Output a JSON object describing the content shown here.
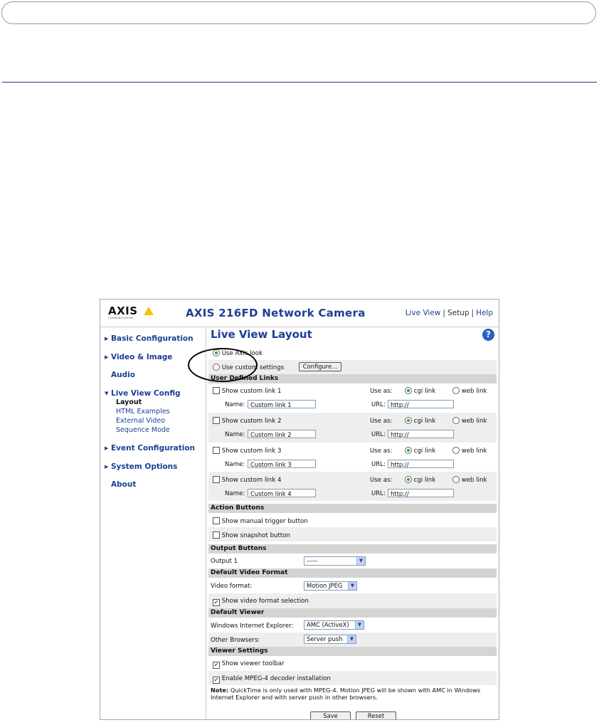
{
  "document": {},
  "app": {
    "logo_text": "AXIS",
    "logo_sub": "COMMUNICATIONS",
    "product_title": "AXIS 216FD Network Camera",
    "top_links": [
      "Live View",
      "Setup",
      "Help"
    ],
    "separator": "|"
  },
  "nav": {
    "items": [
      {
        "label": "Basic Configuration",
        "arrow": "▶"
      },
      {
        "label": "Video & Image",
        "arrow": "▶"
      },
      {
        "label": "Audio",
        "arrow": ""
      },
      {
        "label": "Live View Config",
        "arrow": "▼"
      },
      {
        "label": "Event Configuration",
        "arrow": "▶"
      },
      {
        "label": "System Options",
        "arrow": "▶"
      },
      {
        "label": "About",
        "arrow": ""
      }
    ],
    "sub_items": [
      "Layout",
      "HTML Examples",
      "External Video",
      "Sequence Mode"
    ]
  },
  "page": {
    "title": "Live View Layout",
    "help_glyph": "?",
    "use_axis_look": "Use Axis look",
    "use_custom_settings": "Use custom settings",
    "configure_button": "Configure..."
  },
  "sections": {
    "user_defined_links": "User Defined Links",
    "action_buttons": "Action Buttons",
    "output_buttons": "Output Buttons",
    "default_video_format": "Default Video Format",
    "default_viewer": "Default Viewer",
    "viewer_settings": "Viewer Settings"
  },
  "custom_links": [
    {
      "label": "Show custom link 1",
      "name_label": "Name:",
      "name": "Custom link 1",
      "use_as": "Use as:",
      "cgi": "cgi link",
      "web": "web link",
      "url_label": "URL:",
      "url": "http://"
    },
    {
      "label": "Show custom link 2",
      "name_label": "Name:",
      "name": "Custom link 2",
      "use_as": "Use as:",
      "cgi": "cgi link",
      "web": "web link",
      "url_label": "URL:",
      "url": "http://"
    },
    {
      "label": "Show custom link 3",
      "name_label": "Name:",
      "name": "Custom link 3",
      "use_as": "Use as:",
      "cgi": "cgi link",
      "web": "web link",
      "url_label": "URL:",
      "url": "http://"
    },
    {
      "label": "Show custom link 4",
      "name_label": "Name:",
      "name": "Custom link 4",
      "use_as": "Use as:",
      "cgi": "cgi link",
      "web": "web link",
      "url_label": "URL:",
      "url": "http://"
    }
  ],
  "action_buttons": {
    "manual_trigger": "Show manual trigger button",
    "snapshot": "Show snapshot button"
  },
  "output_buttons": {
    "output1_label": "Output 1",
    "output1_value": "-----"
  },
  "video_format": {
    "label": "Video format:",
    "value": "Motion JPEG",
    "show_selection": "Show video format selection",
    "check_glyph": "✔"
  },
  "default_viewer": {
    "ie_label": "Windows Internet Explorer:",
    "ie_value": "AMC (ActiveX)",
    "other_label": "Other Browsers:",
    "other_value": "Server push"
  },
  "viewer_settings": {
    "toolbar": "Show viewer toolbar",
    "mpeg4": "Enable MPEG-4 decoder installation"
  },
  "note": {
    "bold": "Note:",
    "text": "QuickTime is only used with MPEG-4. Motion JPEG will be shown with AMC in Windows Internet Explorer and with server push in other browsers."
  },
  "buttons": {
    "save": "Save",
    "reset": "Reset"
  }
}
